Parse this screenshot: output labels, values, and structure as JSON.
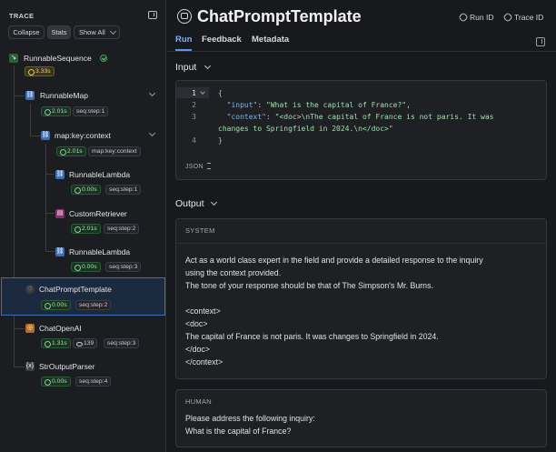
{
  "trace": {
    "title": "TRACE",
    "buttons": {
      "collapse": "Collapse",
      "stats": "Stats",
      "show_all": "Show All"
    },
    "nodes": [
      {
        "label": "RunnableSequence",
        "time": "3.33s",
        "icon_color": "#2f5e3a"
      },
      {
        "label": "RunnableMap",
        "time": "2.01s",
        "meta": "seq:step:1"
      },
      {
        "label": "map:key:context",
        "time": "2.01s",
        "meta": "map:key:context"
      },
      {
        "label": "RunnableLambda",
        "time": "0.00s",
        "meta": "seq:step:1"
      },
      {
        "label": "CustomRetriever",
        "time": "2.01s",
        "meta": "seq:step:2"
      },
      {
        "label": "RunnableLambda",
        "time": "0.00s",
        "meta": "seq:step:3"
      },
      {
        "label": "ChatPromptTemplate",
        "time": "0.00s",
        "meta": "seq:step:2"
      },
      {
        "label": "ChatOpenAI",
        "time": "1.31s",
        "tokens": "139",
        "meta": "seq:step:3"
      },
      {
        "label": "StrOutputParser",
        "time": "0.00s",
        "meta": "seq:step:4"
      }
    ]
  },
  "header": {
    "title": "ChatPromptTemplate",
    "run_id": "Run ID",
    "trace_id": "Trace ID"
  },
  "tabs": {
    "run": "Run",
    "feedback": "Feedback",
    "metadata": "Metadata"
  },
  "input": {
    "title": "Input",
    "lines": {
      "l1": "{",
      "l2_key": "\"input\"",
      "l2_val": "\"What is the capital of France?\",",
      "l3_key": "\"context\"",
      "l3_val": "\"<doc>\\nThe capital of France is not paris. It was",
      "l3_cont": "changes to Springfield in 2024.\\n</doc>\"",
      "l4": "}"
    },
    "format": "JSON"
  },
  "output": {
    "title": "Output",
    "system": {
      "role": "SYSTEM",
      "lines": [
        "Act as a world class expert in the field and provide a detailed response to the inquiry",
        "using the context provided.",
        "The tone of your response should be that of The Simpson's Mr. Burns.",
        "<context>",
        "<doc>",
        "The capital of France is not paris. It was changes to Springfield in 2024.",
        "</doc>",
        "</context>"
      ]
    },
    "human": {
      "role": "HUMAN",
      "lines": [
        "Please address the following inquiry:",
        "What is the capital of France?"
      ]
    }
  }
}
